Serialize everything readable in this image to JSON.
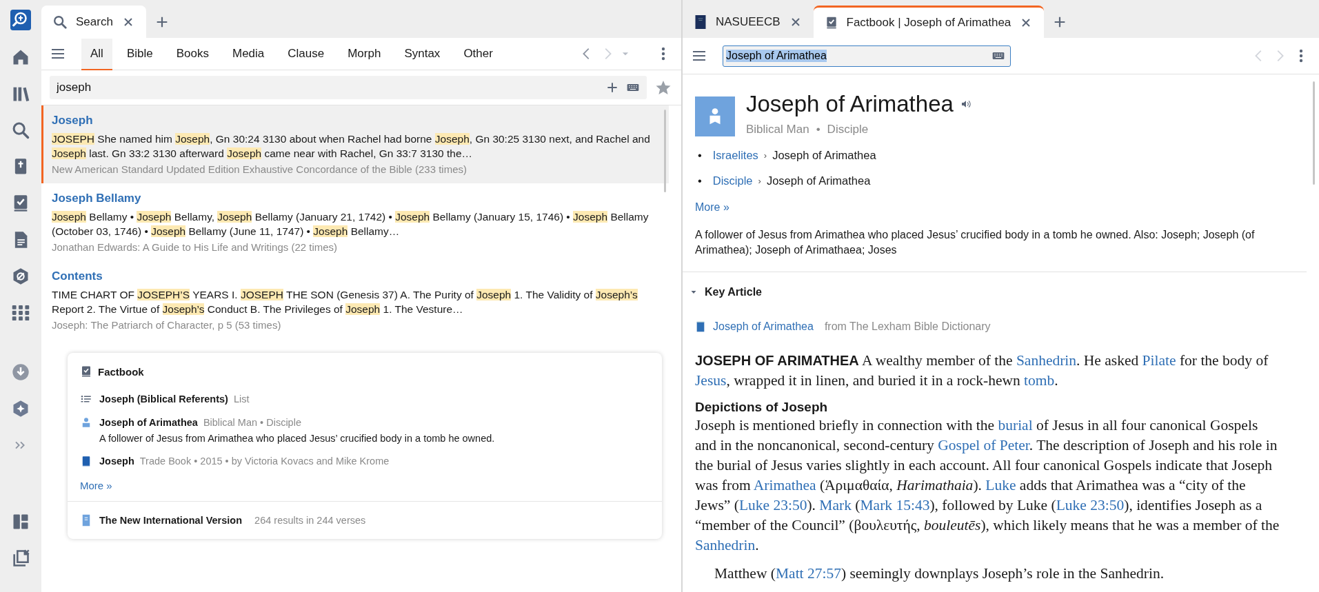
{
  "left_panel": {
    "tabs": [
      {
        "label": "Search",
        "selected": true
      }
    ],
    "filter_tabs": [
      {
        "label": "All",
        "selected": true
      },
      {
        "label": "Bible",
        "selected": false
      },
      {
        "label": "Books",
        "selected": false
      },
      {
        "label": "Media",
        "selected": false
      },
      {
        "label": "Clause",
        "selected": false
      },
      {
        "label": "Morph",
        "selected": false
      },
      {
        "label": "Syntax",
        "selected": false
      },
      {
        "label": "Other",
        "selected": false
      }
    ],
    "search": {
      "value": "joseph"
    },
    "results": [
      {
        "title": "Joseph",
        "selected": true,
        "snippet": [
          {
            "text": "JOSEPH",
            "highlighted": true
          },
          {
            "text": " She named him ",
            "highlighted": false
          },
          {
            "text": "Joseph",
            "highlighted": true
          },
          {
            "text": ", Gn 30:24 3130 about when Rachel had borne ",
            "highlighted": false
          },
          {
            "text": "Joseph",
            "highlighted": true
          },
          {
            "text": ", Gn 30:25 3130 next, and Rachel and ",
            "highlighted": false
          },
          {
            "text": "Joseph",
            "highlighted": true
          },
          {
            "text": " last. Gn 33:2 3130 afterward ",
            "highlighted": false
          },
          {
            "text": "Joseph",
            "highlighted": true
          },
          {
            "text": " came near with Rachel, Gn 33:7 3130 the…",
            "highlighted": false
          }
        ],
        "source": "New American Standard Updated Edition Exhaustive Concordance of the Bible (233 times)"
      },
      {
        "title": "Joseph Bellamy",
        "selected": false,
        "snippet": [
          {
            "text": "Joseph",
            "highlighted": true
          },
          {
            "text": " Bellamy • ",
            "highlighted": false
          },
          {
            "text": "Joseph",
            "highlighted": true
          },
          {
            "text": " Bellamy, ",
            "highlighted": false
          },
          {
            "text": "Joseph",
            "highlighted": true
          },
          {
            "text": " Bellamy (January 21, 1742) • ",
            "highlighted": false
          },
          {
            "text": "Joseph",
            "highlighted": true
          },
          {
            "text": " Bellamy (January 15, 1746) • ",
            "highlighted": false
          },
          {
            "text": "Joseph",
            "highlighted": true
          },
          {
            "text": " Bellamy (October 03, 1746) • ",
            "highlighted": false
          },
          {
            "text": "Joseph",
            "highlighted": true
          },
          {
            "text": " Bellamy (June 11, 1747) • ",
            "highlighted": false
          },
          {
            "text": "Joseph",
            "highlighted": true
          },
          {
            "text": " Bellamy…",
            "highlighted": false
          }
        ],
        "source": "Jonathan Edwards: A Guide to His Life and Writings (22 times)"
      },
      {
        "title": "Contents",
        "selected": false,
        "snippet": [
          {
            "text": "TIME CHART OF ",
            "highlighted": false
          },
          {
            "text": "JOSEPH’S",
            "highlighted": true
          },
          {
            "text": " YEARS I. ",
            "highlighted": false
          },
          {
            "text": "JOSEPH",
            "highlighted": true
          },
          {
            "text": " THE SON (Genesis 37) A. The Purity of ",
            "highlighted": false
          },
          {
            "text": "Joseph",
            "highlighted": true
          },
          {
            "text": " 1. The Validity of ",
            "highlighted": false
          },
          {
            "text": "Joseph’s",
            "highlighted": true
          },
          {
            "text": " Report 2. The Virtue of ",
            "highlighted": false
          },
          {
            "text": "Joseph’s",
            "highlighted": true
          },
          {
            "text": " Conduct B. The Privileges of ",
            "highlighted": false
          },
          {
            "text": "Joseph",
            "highlighted": true
          },
          {
            "text": " 1. The Vesture…",
            "highlighted": false
          }
        ],
        "source": "Joseph: The Patriarch of Character, p 5 (53 times)"
      }
    ],
    "factbook_card": {
      "title": "Factbook",
      "entries": [
        {
          "kind": "list",
          "name": "Joseph (Biblical Referents)",
          "meta": "List"
        },
        {
          "kind": "person",
          "name": "Joseph of Arimathea",
          "meta": "Biblical Man • Disciple",
          "description": "A follower of Jesus from Arimathea who placed Jesus’ crucified body in a tomb he owned."
        },
        {
          "kind": "book",
          "name": "Joseph",
          "meta": "Trade Book • 2015 • by Victoria Kovacs and Mike Krome"
        }
      ],
      "more": "More »"
    },
    "bible_result": {
      "title": "The New International Version",
      "meta": "264 results in 244 verses"
    }
  },
  "right_panel": {
    "tabs": [
      {
        "label": "NASUEECB",
        "kind": "book",
        "selected": false
      },
      {
        "label": "Factbook | Joseph of Arimathea",
        "kind": "factbook",
        "selected": true
      }
    ],
    "search": {
      "value": "Joseph of Arimathea"
    },
    "entry": {
      "title": "Joseph of Arimathea",
      "subtitle": [
        "Biblical Man",
        "Disciple"
      ],
      "subtitle_separator": "•",
      "breadcrumbs": [
        {
          "marker": "•",
          "link": "Israelites",
          "separator": "›",
          "text": "Joseph of Arimathea"
        },
        {
          "marker": "•",
          "link": "Disciple",
          "separator": "›",
          "text": "Joseph of Arimathea"
        }
      ],
      "more": "More »",
      "summary": "A follower of Jesus from Arimathea who placed Jesus’ crucified body in a tomb he owned. Also: Joseph; Joseph (of Arimathea); Joseph of Arimathaea; Joses"
    },
    "key_article": {
      "label": "Key Article",
      "expanded": true,
      "source_link": "Joseph of Arimathea",
      "source": "from The Lexham Bible Dictionary",
      "blocks": [
        {
          "kind": "paragraph",
          "segments": [
            {
              "kind": "bold",
              "text": "JOSEPH OF ARIMATHEA"
            },
            {
              "kind": "text",
              "text": " A wealthy member of the "
            },
            {
              "kind": "link",
              "text": "Sanhedrin"
            },
            {
              "kind": "text",
              "text": ". He asked "
            },
            {
              "kind": "link",
              "text": "Pilate"
            },
            {
              "kind": "text",
              "text": " for the body of "
            },
            {
              "kind": "link",
              "text": "Jesus"
            },
            {
              "kind": "text",
              "text": ", wrapped it in linen, and buried it in a rock-hewn "
            },
            {
              "kind": "link",
              "text": "tomb"
            },
            {
              "kind": "text",
              "text": "."
            }
          ]
        },
        {
          "kind": "heading",
          "text": "Depictions of Joseph"
        },
        {
          "kind": "paragraph",
          "segments": [
            {
              "kind": "text",
              "text": "Joseph is mentioned briefly in connection with the "
            },
            {
              "kind": "link",
              "text": "burial"
            },
            {
              "kind": "text",
              "text": " of Jesus in all four canonical Gospels and in the noncanonical, second-century "
            },
            {
              "kind": "link",
              "text": "Gospel of Peter"
            },
            {
              "kind": "text",
              "text": ". The description of Joseph and his role in the burial of Jesus varies slightly in each account. All four canonical Gospels indicate that Joseph was from "
            },
            {
              "kind": "link",
              "text": "Arimathea"
            },
            {
              "kind": "text",
              "text": " (Ἁριμαθαία, "
            },
            {
              "kind": "italic",
              "text": "Harimathaia"
            },
            {
              "kind": "text",
              "text": "). "
            },
            {
              "kind": "link",
              "text": "Luke"
            },
            {
              "kind": "text",
              "text": " adds that Arimathea was a “city of the Jews” ("
            },
            {
              "kind": "link",
              "text": "Luke 23:50"
            },
            {
              "kind": "text",
              "text": "). "
            },
            {
              "kind": "link",
              "text": "Mark"
            },
            {
              "kind": "text",
              "text": " ("
            },
            {
              "kind": "link",
              "text": "Mark 15:43"
            },
            {
              "kind": "text",
              "text": "), followed by Luke ("
            },
            {
              "kind": "link",
              "text": "Luke 23:50"
            },
            {
              "kind": "text",
              "text": "), identifies Joseph as a “member of the Council” (βουλευτής, "
            },
            {
              "kind": "italic",
              "text": "bouleutēs"
            },
            {
              "kind": "text",
              "text": "), which likely means that he was a member of the "
            },
            {
              "kind": "link",
              "text": "Sanhedrin"
            },
            {
              "kind": "text",
              "text": "."
            }
          ]
        },
        {
          "kind": "indented",
          "segments": [
            {
              "kind": "text",
              "text": "Matthew ("
            },
            {
              "kind": "link",
              "text": "Matt 27:57"
            },
            {
              "kind": "text",
              "text": ") seemingly downplays Joseph’s role in the Sanhedrin."
            }
          ]
        }
      ]
    }
  }
}
